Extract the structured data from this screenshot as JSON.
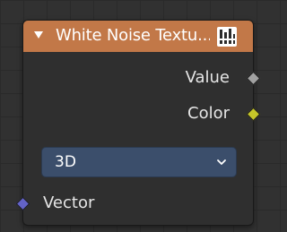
{
  "node": {
    "title": "White Noise Textu...",
    "header_color": "#c27848",
    "collapse_icon": "triangle-down-icon",
    "node_wrangler_icon": "node-wrangler-icon"
  },
  "outputs": [
    {
      "label": "Value",
      "socket_color": "#a1a1a1"
    },
    {
      "label": "Color",
      "socket_color": "#c7c729"
    }
  ],
  "dimensions_dropdown": {
    "value": "3D",
    "background": "#3b4e6b",
    "chevron_icon": "chevron-down-icon"
  },
  "inputs": [
    {
      "label": "Vector",
      "socket_color": "#6363c7"
    }
  ]
}
